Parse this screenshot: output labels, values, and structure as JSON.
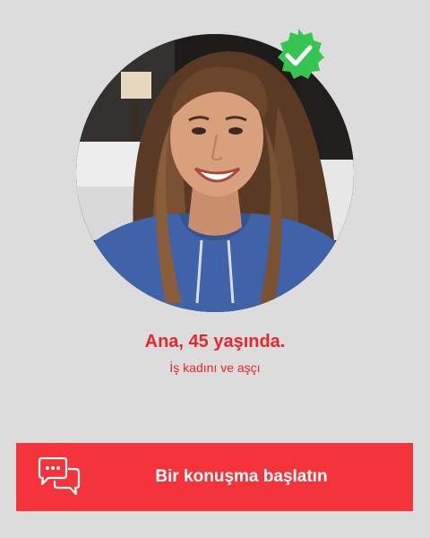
{
  "profile": {
    "name_age": "Ana, 45 yaşında.",
    "occupation": "İş kadını ve aşçı",
    "verified": true
  },
  "cta": {
    "label": "Bir konuşma başlatın",
    "icon": "chat-bubbles-icon"
  },
  "colors": {
    "background": "#dcdcdc",
    "accent": "#f5333a",
    "text_accent": "#e8262b",
    "badge": "#36c453"
  }
}
